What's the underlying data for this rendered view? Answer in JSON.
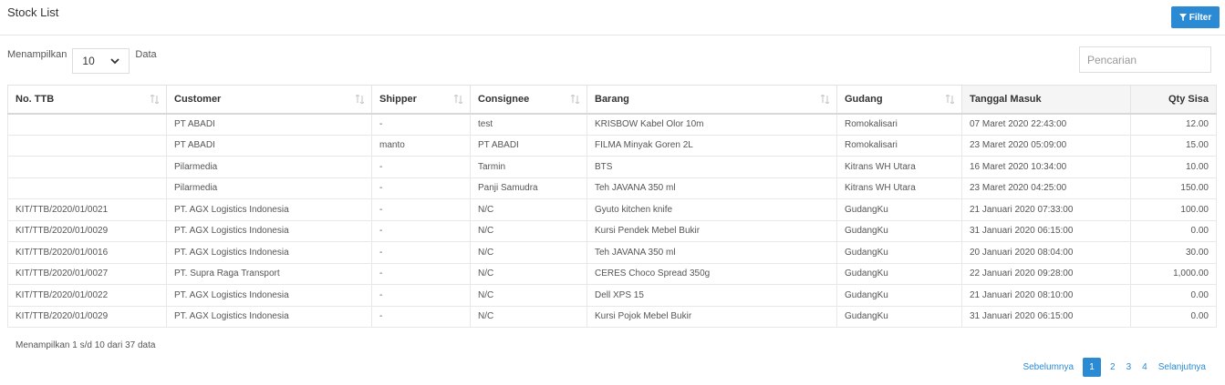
{
  "page": {
    "title": "Stock List",
    "filter_label": "Filter"
  },
  "length": {
    "prefix": "Menampilkan",
    "value": "10",
    "suffix": "Data"
  },
  "search": {
    "placeholder": "Pencarian"
  },
  "table": {
    "columns": [
      "No. TTB",
      "Customer",
      "Shipper",
      "Consignee",
      "Barang",
      "Gudang",
      "Tanggal Masuk",
      "Qty Sisa"
    ],
    "rows": [
      [
        "",
        "PT ABADI",
        "-",
        "test",
        "KRISBOW Kabel Olor 10m",
        "Romokalisari",
        "07 Maret 2020 22:43:00",
        "12.00"
      ],
      [
        "",
        "PT ABADI",
        "manto",
        "PT ABADI",
        "FILMA Minyak Goren 2L",
        "Romokalisari",
        "23 Maret 2020 05:09:00",
        "15.00"
      ],
      [
        "",
        "Pilarmedia",
        "-",
        "Tarmin",
        "BTS",
        "Kitrans WH Utara",
        "16 Maret 2020 10:34:00",
        "10.00"
      ],
      [
        "",
        "Pilarmedia",
        "-",
        "Panji Samudra",
        "Teh JAVANA 350 ml",
        "Kitrans WH Utara",
        "23 Maret 2020 04:25:00",
        "150.00"
      ],
      [
        "KIT/TTB/2020/01/0021",
        "PT. AGX Logistics Indonesia",
        "-",
        "N/C",
        "Gyuto kitchen knife",
        "GudangKu",
        "21 Januari 2020 07:33:00",
        "100.00"
      ],
      [
        "KIT/TTB/2020/01/0029",
        "PT. AGX Logistics Indonesia",
        "-",
        "N/C",
        "Kursi Pendek Mebel Bukir",
        "GudangKu",
        "31 Januari 2020 06:15:00",
        "0.00"
      ],
      [
        "KIT/TTB/2020/01/0016",
        "PT. AGX Logistics Indonesia",
        "-",
        "N/C",
        "Teh JAVANA 350 ml",
        "GudangKu",
        "20 Januari 2020 08:04:00",
        "30.00"
      ],
      [
        "KIT/TTB/2020/01/0027",
        "PT. Supra Raga Transport",
        "-",
        "N/C",
        "CERES Choco Spread 350g",
        "GudangKu",
        "22 Januari 2020 09:28:00",
        "1,000.00"
      ],
      [
        "KIT/TTB/2020/01/0022",
        "PT. AGX Logistics Indonesia",
        "-",
        "N/C",
        "Dell XPS 15",
        "GudangKu",
        "21 Januari 2020 08:10:00",
        "0.00"
      ],
      [
        "KIT/TTB/2020/01/0029",
        "PT. AGX Logistics Indonesia",
        "-",
        "N/C",
        "Kursi Pojok Mebel Bukir",
        "GudangKu",
        "31 Januari 2020 06:15:00",
        "0.00"
      ]
    ]
  },
  "info": "Menampilkan 1 s/d 10 dari 37 data",
  "pagination": {
    "prev": "Sebelumnya",
    "pages": [
      "1",
      "2",
      "3",
      "4"
    ],
    "active_page": "1",
    "next": "Selanjutnya"
  },
  "colors": {
    "accent": "#2a8ad4"
  },
  "icons": {
    "filter": "filter-icon",
    "sort": "sort-icon",
    "dropdown": "chevron-down-icon"
  }
}
